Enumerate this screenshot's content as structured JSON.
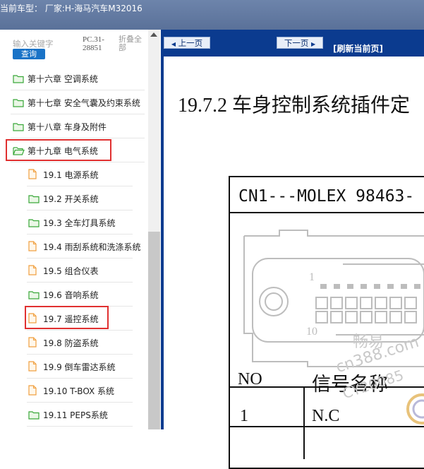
{
  "window": {
    "title": "当前车型：  厂家:H-海马汽车M32016"
  },
  "left_panel": {
    "search_placeholder": "输入关键字",
    "search_button": "查询",
    "pc_code": "PC.31-28851",
    "collapse_all": "折叠全部",
    "tree_items": [
      {
        "label": "第十六章 空调系统",
        "icon": "folder-closed-icon"
      },
      {
        "label": "第十七章 安全气囊及约束系统",
        "icon": "folder-closed-icon"
      },
      {
        "label": "第十八章 车身及附件",
        "icon": "folder-closed-icon"
      },
      {
        "label": "第十九章 电气系统",
        "icon": "folder-open-icon",
        "highlighted": true
      },
      {
        "label": "19.1 电源系统",
        "icon": "document-icon"
      },
      {
        "label": "19.2 开关系统",
        "icon": "folder-closed-icon"
      },
      {
        "label": "19.3 全车灯具系统",
        "icon": "folder-closed-icon"
      },
      {
        "label": "19.4 雨刮系统和洗涤系统",
        "icon": "document-icon"
      },
      {
        "label": "19.5 组合仪表",
        "icon": "document-icon"
      },
      {
        "label": "19.6 音响系统",
        "icon": "folder-closed-icon"
      },
      {
        "label": "19.7 遥控系统",
        "icon": "document-icon",
        "highlighted": true
      },
      {
        "label": "19.8 防盗系统",
        "icon": "document-icon"
      },
      {
        "label": "19.9 倒车雷达系统",
        "icon": "document-icon"
      },
      {
        "label": "19.10 T-BOX 系统",
        "icon": "document-icon"
      },
      {
        "label": "19.11 PEPS系统",
        "icon": "folder-closed-icon"
      }
    ]
  },
  "toolbar": {
    "prev_label": "上一页",
    "next_label": "下一页",
    "refresh_label": "[刷新当前页]"
  },
  "document": {
    "title": "19.7.2 车身控制系统插件定",
    "connector_header": "CN1---MOLEX 98463-",
    "connector_pin_labels": [
      "1",
      "10"
    ],
    "column_headers": [
      "NO",
      "信号名称"
    ],
    "rows": [
      {
        "no": "1",
        "signal": "N.C"
      }
    ],
    "watermark": [
      "畅易",
      "cn388.com",
      "CY20085"
    ]
  },
  "colors": {
    "titlebar": "#6d84ab",
    "toolbar": "#0b3b8f",
    "search_button": "#1a73c7",
    "highlight": "#e03030",
    "folder_green": "#3aa83a",
    "doc_orange": "#f0a040"
  }
}
